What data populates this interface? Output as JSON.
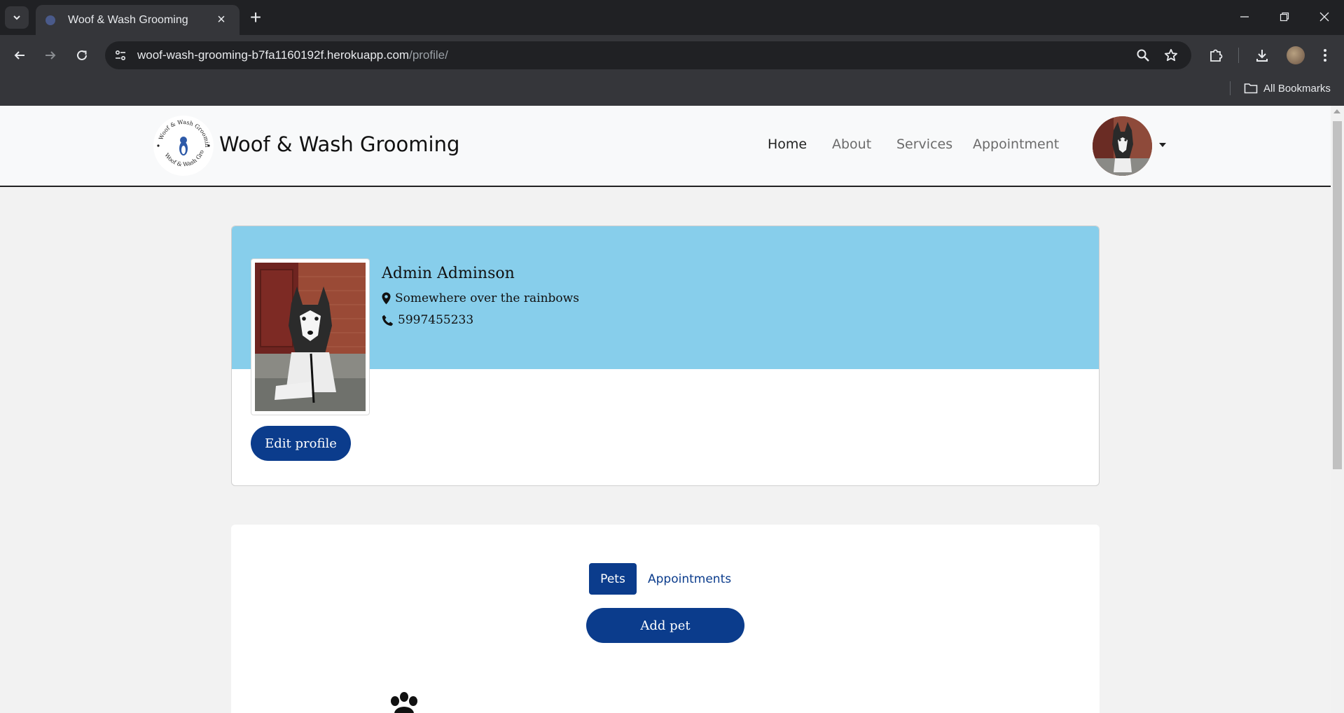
{
  "browser": {
    "tab_title": "Woof & Wash Grooming",
    "url_host": "woof-wash-grooming-b7fa1160192f.herokuapp.com",
    "url_path": "/profile/",
    "bookmarks_label": "All Bookmarks"
  },
  "site": {
    "brand": "Woof & Wash Grooming",
    "nav": [
      {
        "label": "Home",
        "active": true
      },
      {
        "label": "About",
        "active": false
      },
      {
        "label": "Services",
        "active": false
      },
      {
        "label": "Appointment",
        "active": false
      }
    ]
  },
  "profile": {
    "name": "Admin Adminson",
    "location": "Somewhere over the rainbows",
    "phone": "5997455233",
    "edit_label": "Edit profile"
  },
  "pets_section": {
    "tabs": [
      {
        "label": "Pets",
        "active": true
      },
      {
        "label": "Appointments",
        "active": false
      }
    ],
    "add_label": "Add pet"
  },
  "colors": {
    "accent": "#0b3c8c",
    "profile_band": "#87ceeb"
  }
}
